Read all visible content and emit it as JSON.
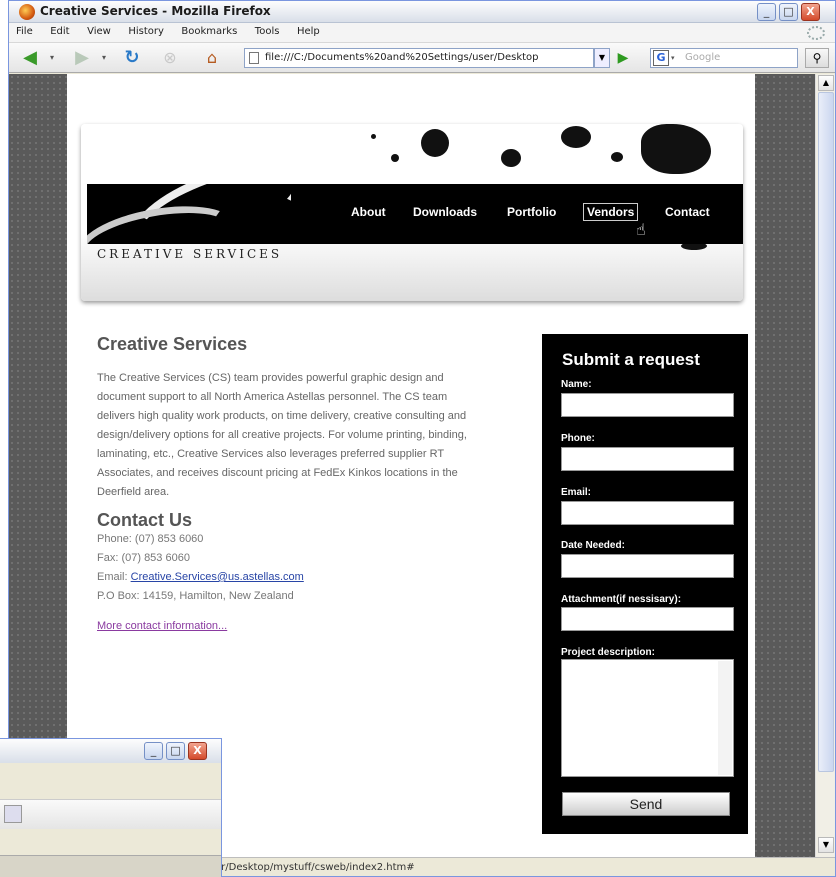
{
  "window": {
    "title": "Creative Services - Mozilla Firefox",
    "minimize": "_",
    "maximize": "□",
    "close": "X"
  },
  "menu": [
    "File",
    "Edit",
    "View",
    "History",
    "Bookmarks",
    "Tools",
    "Help"
  ],
  "navbar": {
    "url": "file:///C:/Documents%20and%20Settings/user/Desktop",
    "search_placeholder": "Google",
    "search_engine_icon": "G"
  },
  "site": {
    "brand": "CREATIVE SERVICES",
    "nav": [
      "About",
      "Downloads",
      "Portfolio",
      "Vendors",
      "Contact"
    ],
    "heading": "Creative Services",
    "intro": "The Creative Services (CS) team provides powerful graphic design and document support to all North America Astellas personnel. The CS team delivers high quality work products, on time delivery, creative consulting and design/delivery options for all creative projects. For volume printing, binding, laminating, etc., Creative Services also leverages preferred supplier RT Associates, and receives discount pricing at FedEx Kinkos locations in the Deerfield area.",
    "contact_heading": "Contact Us",
    "phone": "Phone: (07) 853 6060",
    "fax": "Fax: (07) 853 6060",
    "email_label": "Email: ",
    "email_link": "Creative.Services@us.astellas.com",
    "pobox": "P.O Box: 14159, Hamilton, New Zealand",
    "more_link": "More contact information..."
  },
  "form": {
    "title": "Submit a request",
    "name_label": "Name:",
    "phone_label": "Phone:",
    "email_label": "Email:",
    "date_label": "Date Needed:",
    "attachment_label": "Attachment(if nessisary):",
    "description_label": "Project description:",
    "send": "Send"
  },
  "status": {
    "text": "er/Desktop/mystuff/csweb/index2.htm#"
  }
}
